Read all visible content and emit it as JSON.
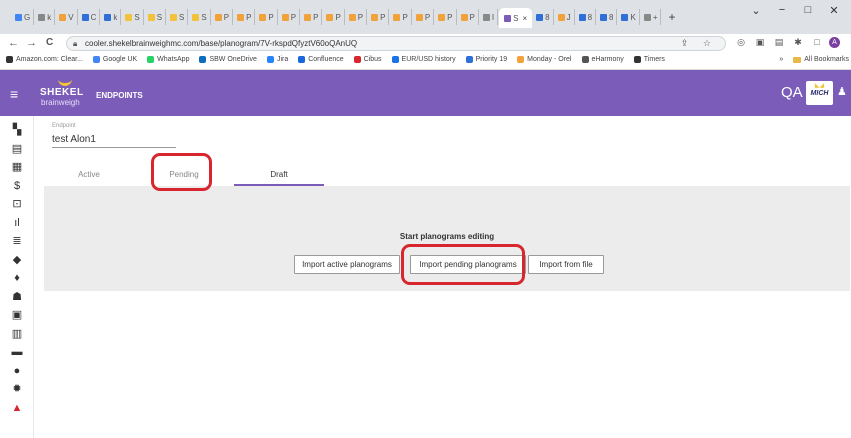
{
  "browser": {
    "tabs": [
      {
        "label": "G",
        "color": "#4285f4"
      },
      {
        "label": "k",
        "color": "#888888"
      },
      {
        "label": "V",
        "color": "#f2a23a"
      },
      {
        "label": "C",
        "color": "#2f6fd8"
      },
      {
        "label": "k",
        "color": "#2f6fd8"
      },
      {
        "label": "S",
        "color": "#f2c23a"
      },
      {
        "label": "S",
        "color": "#f2c23a"
      },
      {
        "label": "S",
        "color": "#f2c23a"
      },
      {
        "label": "S",
        "color": "#f2c23a"
      },
      {
        "label": "P",
        "color": "#f2a23a"
      },
      {
        "label": "P",
        "color": "#f2a23a"
      },
      {
        "label": "P",
        "color": "#f2a23a"
      },
      {
        "label": "P",
        "color": "#f2a23a"
      },
      {
        "label": "P",
        "color": "#f2a23a"
      },
      {
        "label": "P",
        "color": "#f2a23a"
      },
      {
        "label": "P",
        "color": "#f2a23a"
      },
      {
        "label": "P",
        "color": "#f2a23a"
      },
      {
        "label": "P",
        "color": "#f2a23a"
      },
      {
        "label": "P",
        "color": "#f2a23a"
      },
      {
        "label": "P",
        "color": "#f2a23a"
      },
      {
        "label": "P",
        "color": "#f2a23a"
      },
      {
        "label": "I",
        "color": "#888888"
      }
    ],
    "active_tab": {
      "label": "S",
      "close": "×",
      "color": "#7b5cb9"
    },
    "tabs_after": [
      {
        "label": "8",
        "color": "#2f6fd8"
      },
      {
        "label": "J",
        "color": "#f2a23a"
      },
      {
        "label": "8",
        "color": "#2f6fd8"
      },
      {
        "label": "8",
        "color": "#2f6fd8"
      },
      {
        "label": "K",
        "color": "#2f6fd8"
      },
      {
        "label": "+",
        "color": "#888888"
      }
    ],
    "new_tab": "+",
    "window_controls": {
      "chevron": "⌄",
      "minimize": "−",
      "maximize": "□",
      "close": "✕"
    },
    "back": "←",
    "forward": "→",
    "reload": "C",
    "url": "cooler.shekelbrainweighmc.com/base/planogram/7V-rkspdQfyztV60oQAnUQ",
    "omni_icons": "⇪ ☆",
    "extensions": [
      "◎",
      "▣",
      "▤",
      "✱",
      "□"
    ],
    "profile": "A",
    "menu": "⋮",
    "bookmarks": [
      {
        "label": "Amazon.com: Clear...",
        "color": "#333333"
      },
      {
        "label": "Google UK",
        "color": "#4285f4"
      },
      {
        "label": "WhatsApp",
        "color": "#25d366"
      },
      {
        "label": "SBW OneDrive",
        "color": "#0f6cbd"
      },
      {
        "label": "Jira",
        "color": "#2684ff"
      },
      {
        "label": "Confluence",
        "color": "#1868db"
      },
      {
        "label": "Cibus",
        "color": "#d8262e"
      },
      {
        "label": "EUR/USD history",
        "color": "#1a73e8"
      },
      {
        "label": "Priority 19",
        "color": "#2f6fd8"
      },
      {
        "label": "Monday - Orel",
        "color": "#f2a23a"
      },
      {
        "label": "eHarmony",
        "color": "#555555"
      },
      {
        "label": "Timers",
        "color": "#333333"
      }
    ],
    "bookmarks_overflow": "»",
    "all_bookmarks": "All Bookmarks"
  },
  "header": {
    "menu_icon": "≡",
    "logo_brand": "SHEKEL",
    "logo_sub": "brainweigh",
    "title": "ENDPOINTS",
    "env": "QA",
    "badge": "MICH",
    "user_icon": "♟"
  },
  "sidebar": {
    "icons": [
      {
        "name": "dashboard-icon",
        "glyph": "▚"
      },
      {
        "name": "planogram-icon",
        "glyph": "▤"
      },
      {
        "name": "grid-icon",
        "glyph": "▦"
      },
      {
        "name": "dollar-icon",
        "glyph": "$"
      },
      {
        "name": "import-icon",
        "glyph": "⊡"
      },
      {
        "name": "bar-chart-icon",
        "glyph": "ıl"
      },
      {
        "name": "report-icon",
        "glyph": "≣"
      },
      {
        "name": "tag-icon",
        "glyph": "◆"
      },
      {
        "name": "location-icon",
        "glyph": "♦"
      },
      {
        "name": "users-icon",
        "glyph": "☗"
      },
      {
        "name": "badge-icon",
        "glyph": "▣"
      },
      {
        "name": "building-icon",
        "glyph": "▥"
      },
      {
        "name": "truck-icon",
        "glyph": "▬"
      },
      {
        "name": "info-icon",
        "glyph": "●"
      },
      {
        "name": "settings-icon",
        "glyph": "✹"
      },
      {
        "name": "alert-icon",
        "glyph": "▲"
      }
    ]
  },
  "endpoint": {
    "label": "Endpoint",
    "value": "test Alon1"
  },
  "tabs": {
    "active": "Active",
    "pending": "Pending",
    "draft": "Draft"
  },
  "editor": {
    "title": "Start planograms editing",
    "import_active": "Import active planograms",
    "import_pending": "Import pending planograms",
    "import_file": "Import from file"
  },
  "colors": {
    "header": "#7b5cb9",
    "highlight": "#d8262e",
    "panel": "#ececec"
  }
}
